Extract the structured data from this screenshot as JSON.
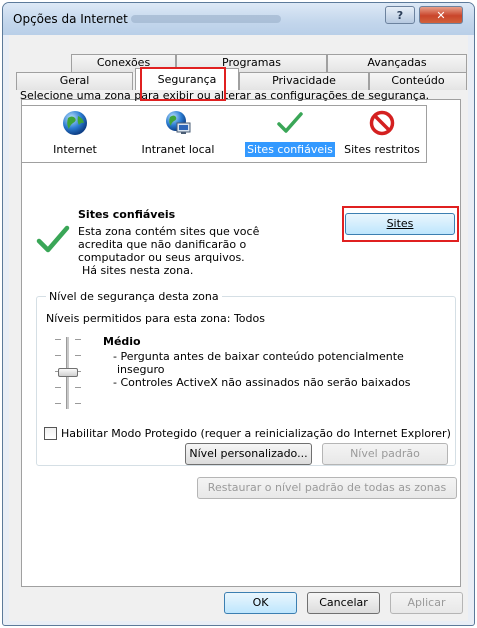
{
  "window": {
    "title": "Opções da Internet",
    "help_label": "?",
    "close_label": "✕"
  },
  "tabs_row1": [
    "Conexões",
    "Programas",
    "Avançadas"
  ],
  "tabs_row2": [
    "Geral",
    "Segurança",
    "Privacidade",
    "Conteúdo"
  ],
  "active_tab": "Segurança",
  "zone_instruction": "Selecione uma zona para exibir ou alterar as configurações de segurança.",
  "zones": [
    {
      "label": "Internet",
      "icon": "globe-icon"
    },
    {
      "label": "Intranet local",
      "icon": "intranet-icon"
    },
    {
      "label": "Sites confiáveis",
      "icon": "checkmark-icon",
      "selected": true
    },
    {
      "label": "Sites restritos",
      "icon": "restricted-icon"
    }
  ],
  "selected_zone": {
    "title": "Sites confiáveis",
    "description": [
      "Esta zona contém sites que você",
      "acredita que não danificarão o",
      "computador ou seus arquivos.",
      "Há sites nesta zona."
    ],
    "sites_button": "Sites"
  },
  "security_level": {
    "group_title": "Nível de segurança desta zona",
    "allowed_levels": "Níveis permitidos para esta zona: Todos",
    "level_name": "Médio",
    "level_details": [
      "- Pergunta antes de baixar conteúdo potencialmente",
      "inseguro",
      "- Controles ActiveX não assinados não serão baixados"
    ],
    "slider_position": "Médio",
    "protected_mode_label": "Habilitar Modo Protegido (requer a reinicialização do Internet Explorer)",
    "protected_mode_checked": false,
    "custom_level_button": "Nível personalizado...",
    "default_level_button": "Nível padrão"
  },
  "restore_all_button": "Restaurar o nível padrão de todas as zonas",
  "footer": {
    "ok": "OK",
    "cancel": "Cancelar",
    "apply": "Aplicar"
  },
  "colors": {
    "highlight": "#e02020",
    "selection": "#3399ff"
  }
}
